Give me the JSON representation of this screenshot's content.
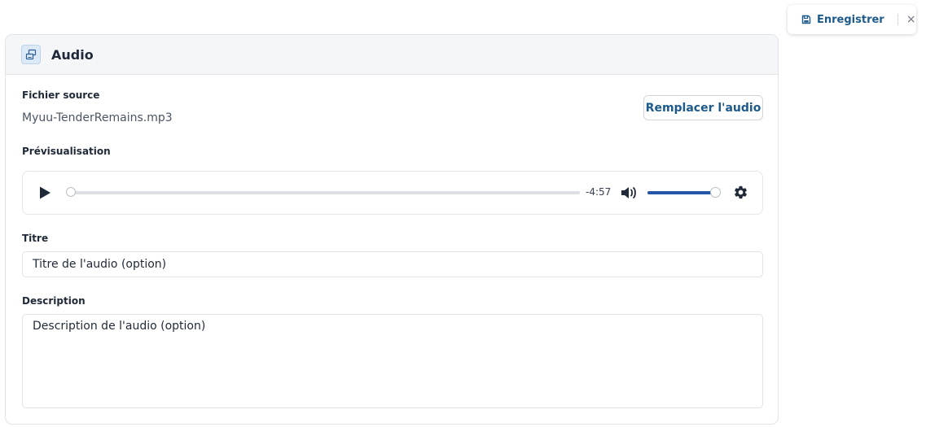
{
  "toolbar": {
    "save_label": "Enregistrer",
    "close_label": "×"
  },
  "card": {
    "title": "Audio",
    "source_label": "Fichier source",
    "file_name": "Myuu-TenderRemains.mp3",
    "replace_label": "Remplacer l'audio",
    "preview_label": "Prévisualisation",
    "player": {
      "remaining_time": "-4:57",
      "progress": 0,
      "volume": 1.0
    },
    "title_field": {
      "label": "Titre",
      "placeholder": "Titre de l'audio (option)",
      "value": ""
    },
    "description_field": {
      "label": "Description",
      "placeholder": "Description de l'audio (option)",
      "value": ""
    }
  },
  "colors": {
    "accent": "#1d5a8c",
    "volume_fill": "#2556a6",
    "header_bg": "#f5f6f8"
  }
}
